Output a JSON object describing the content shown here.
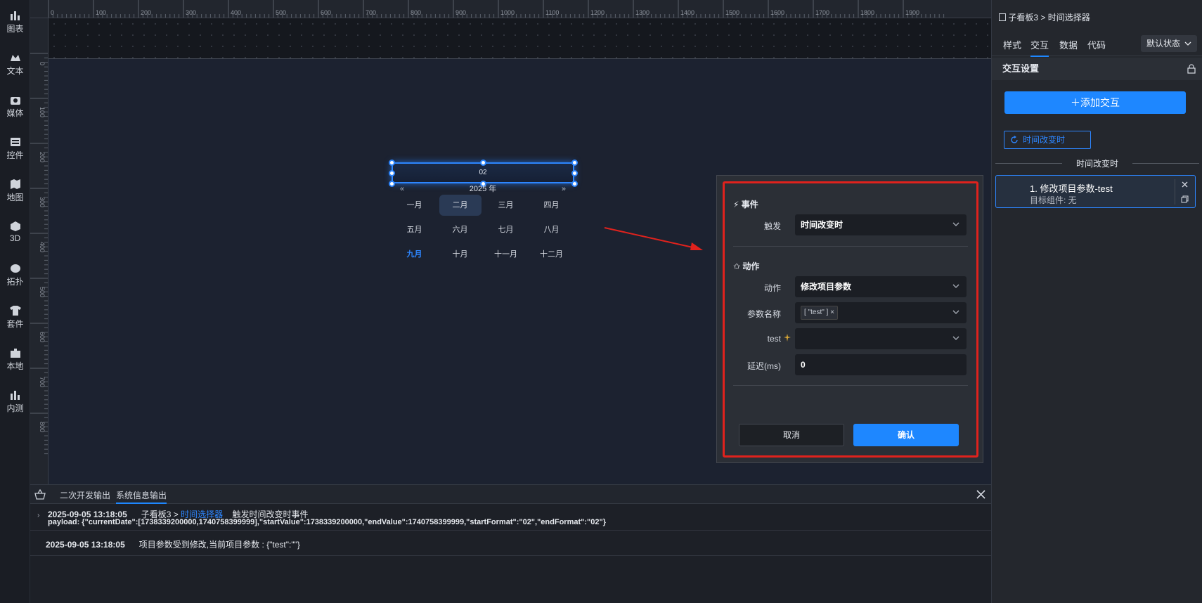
{
  "left_toolbar": [
    {
      "label": "图表",
      "icon": "chart-icon"
    },
    {
      "label": "文本",
      "icon": "text-icon"
    },
    {
      "label": "媒体",
      "icon": "media-icon"
    },
    {
      "label": "控件",
      "icon": "widget-icon"
    },
    {
      "label": "地图",
      "icon": "map-icon"
    },
    {
      "label": "3D",
      "icon": "cube-icon"
    },
    {
      "label": "拓扑",
      "icon": "topology-icon"
    },
    {
      "label": "套件",
      "icon": "suite-icon"
    },
    {
      "label": "本地",
      "icon": "puzzle-icon"
    },
    {
      "label": "内测",
      "icon": "beta-chart-icon"
    }
  ],
  "ruler": {
    "top_ticks": [
      "0",
      "100",
      "200",
      "300",
      "400",
      "500",
      "600",
      "700",
      "800",
      "900",
      "1000",
      "1100",
      "1200",
      "1300",
      "1400",
      "1500",
      "1600",
      "1700",
      "1800",
      "1900"
    ],
    "left_ticks": [
      "0",
      "100",
      "200",
      "300",
      "400",
      "500",
      "600",
      "700",
      "800"
    ]
  },
  "date_picker": {
    "input_value": "02",
    "year_label": "2025 年",
    "prev_symbol": "«",
    "next_symbol": "»",
    "months": [
      "一月",
      "二月",
      "三月",
      "四月",
      "五月",
      "六月",
      "七月",
      "八月",
      "九月",
      "十月",
      "十一月",
      "十二月"
    ],
    "selected_month_index": 1,
    "current_month_index": 8
  },
  "dialog": {
    "event_section": "事件",
    "trigger_label": "触发",
    "trigger_value": "时间改变时",
    "action_section": "动作",
    "action_label": "动作",
    "action_value": "修改项目参数",
    "param_name_label": "参数名称",
    "param_tag": "[ \"test\" ]",
    "test_label": "test",
    "delay_label": "延迟(ms)",
    "delay_value": "0",
    "cancel": "取消",
    "confirm": "确认"
  },
  "console": {
    "tab_dev": "二次开发输出",
    "tab_sys": "系统信息输出",
    "log1_time": "2025-09-05 13:18:05",
    "log1_source": "子看板3 >",
    "log1_link": "时间选择器",
    "log1_msg": "触发时间改变时事件",
    "log1_payload": "payload: {\"currentDate\":[1738339200000,1740758399999],\"startValue\":1738339200000,\"endValue\":1740758399999,\"startFormat\":\"02\",\"endFormat\":\"02\"}",
    "log2_time": "2025-09-05 13:18:05",
    "log2_msg": "项目参数受到修改,当前项目参数 : {\"test\":\"\"}"
  },
  "right_panel": {
    "crumb_board": "子看板3",
    "crumb_sep": ">",
    "crumb_component": "时间选择器",
    "tabs": [
      "样式",
      "交互",
      "数据",
      "代码"
    ],
    "active_tab_index": 1,
    "state_select": "默认状态",
    "section_title": "交互设置",
    "add_button": "＋添加交互",
    "event_chip": "时间改变时",
    "event_group_title": "时间改变时",
    "action_title": "1. 修改项目参数-test",
    "action_sub": "目标组件: 无"
  },
  "colors": {
    "accent": "#1e87ff",
    "highlight_border": "#e0221d"
  }
}
